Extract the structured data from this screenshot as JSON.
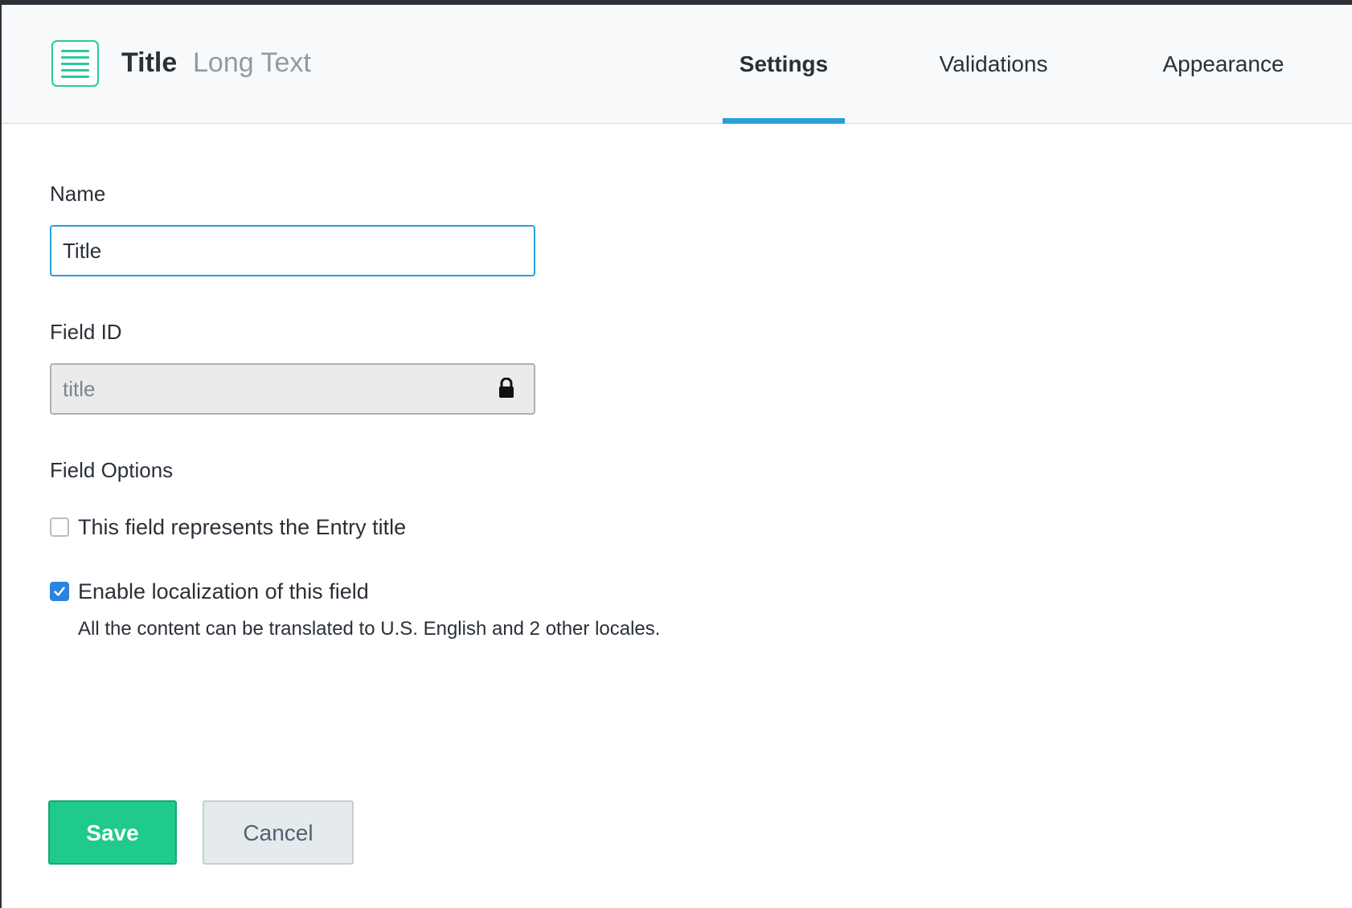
{
  "header": {
    "field_icon": "long-text-icon",
    "title": "Title",
    "field_type": "Long Text",
    "accent_color": "#2cc99a"
  },
  "tabs": [
    {
      "label": "Settings",
      "active": true
    },
    {
      "label": "Validations",
      "active": false
    },
    {
      "label": "Appearance",
      "active": false
    }
  ],
  "tab_indicator_color": "#2a9fd8",
  "form": {
    "name_label": "Name",
    "name_value": "Title",
    "field_id_label": "Field ID",
    "field_id_value": "title",
    "field_id_locked_icon": "lock-icon",
    "field_options_label": "Field Options",
    "options": [
      {
        "label": "This field represents the Entry title",
        "checked": false
      },
      {
        "label": "Enable localization of this field",
        "checked": true,
        "help": "All the content can be translated to U.S. English and 2 other locales."
      }
    ]
  },
  "actions": {
    "save_label": "Save",
    "cancel_label": "Cancel",
    "save_color": "#1fca8a"
  }
}
